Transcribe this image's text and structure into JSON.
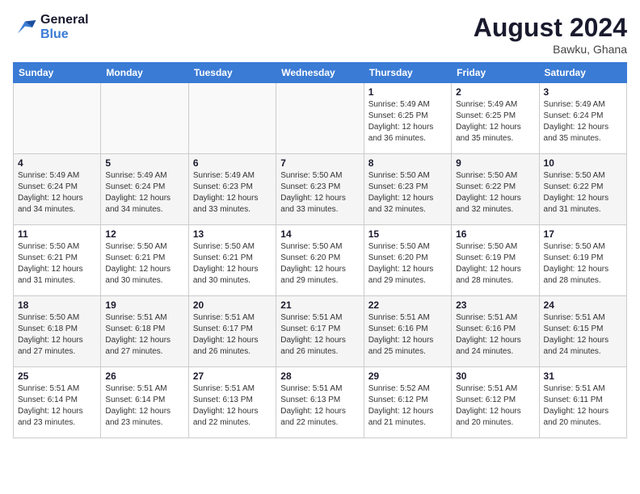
{
  "header": {
    "logo_line1": "General",
    "logo_line2": "Blue",
    "month_year": "August 2024",
    "location": "Bawku, Ghana"
  },
  "days_of_week": [
    "Sunday",
    "Monday",
    "Tuesday",
    "Wednesday",
    "Thursday",
    "Friday",
    "Saturday"
  ],
  "weeks": [
    [
      {
        "day": "",
        "info": ""
      },
      {
        "day": "",
        "info": ""
      },
      {
        "day": "",
        "info": ""
      },
      {
        "day": "",
        "info": ""
      },
      {
        "day": "1",
        "info": "Sunrise: 5:49 AM\nSunset: 6:25 PM\nDaylight: 12 hours\nand 36 minutes."
      },
      {
        "day": "2",
        "info": "Sunrise: 5:49 AM\nSunset: 6:25 PM\nDaylight: 12 hours\nand 35 minutes."
      },
      {
        "day": "3",
        "info": "Sunrise: 5:49 AM\nSunset: 6:24 PM\nDaylight: 12 hours\nand 35 minutes."
      }
    ],
    [
      {
        "day": "4",
        "info": "Sunrise: 5:49 AM\nSunset: 6:24 PM\nDaylight: 12 hours\nand 34 minutes."
      },
      {
        "day": "5",
        "info": "Sunrise: 5:49 AM\nSunset: 6:24 PM\nDaylight: 12 hours\nand 34 minutes."
      },
      {
        "day": "6",
        "info": "Sunrise: 5:49 AM\nSunset: 6:23 PM\nDaylight: 12 hours\nand 33 minutes."
      },
      {
        "day": "7",
        "info": "Sunrise: 5:50 AM\nSunset: 6:23 PM\nDaylight: 12 hours\nand 33 minutes."
      },
      {
        "day": "8",
        "info": "Sunrise: 5:50 AM\nSunset: 6:23 PM\nDaylight: 12 hours\nand 32 minutes."
      },
      {
        "day": "9",
        "info": "Sunrise: 5:50 AM\nSunset: 6:22 PM\nDaylight: 12 hours\nand 32 minutes."
      },
      {
        "day": "10",
        "info": "Sunrise: 5:50 AM\nSunset: 6:22 PM\nDaylight: 12 hours\nand 31 minutes."
      }
    ],
    [
      {
        "day": "11",
        "info": "Sunrise: 5:50 AM\nSunset: 6:21 PM\nDaylight: 12 hours\nand 31 minutes."
      },
      {
        "day": "12",
        "info": "Sunrise: 5:50 AM\nSunset: 6:21 PM\nDaylight: 12 hours\nand 30 minutes."
      },
      {
        "day": "13",
        "info": "Sunrise: 5:50 AM\nSunset: 6:21 PM\nDaylight: 12 hours\nand 30 minutes."
      },
      {
        "day": "14",
        "info": "Sunrise: 5:50 AM\nSunset: 6:20 PM\nDaylight: 12 hours\nand 29 minutes."
      },
      {
        "day": "15",
        "info": "Sunrise: 5:50 AM\nSunset: 6:20 PM\nDaylight: 12 hours\nand 29 minutes."
      },
      {
        "day": "16",
        "info": "Sunrise: 5:50 AM\nSunset: 6:19 PM\nDaylight: 12 hours\nand 28 minutes."
      },
      {
        "day": "17",
        "info": "Sunrise: 5:50 AM\nSunset: 6:19 PM\nDaylight: 12 hours\nand 28 minutes."
      }
    ],
    [
      {
        "day": "18",
        "info": "Sunrise: 5:50 AM\nSunset: 6:18 PM\nDaylight: 12 hours\nand 27 minutes."
      },
      {
        "day": "19",
        "info": "Sunrise: 5:51 AM\nSunset: 6:18 PM\nDaylight: 12 hours\nand 27 minutes."
      },
      {
        "day": "20",
        "info": "Sunrise: 5:51 AM\nSunset: 6:17 PM\nDaylight: 12 hours\nand 26 minutes."
      },
      {
        "day": "21",
        "info": "Sunrise: 5:51 AM\nSunset: 6:17 PM\nDaylight: 12 hours\nand 26 minutes."
      },
      {
        "day": "22",
        "info": "Sunrise: 5:51 AM\nSunset: 6:16 PM\nDaylight: 12 hours\nand 25 minutes."
      },
      {
        "day": "23",
        "info": "Sunrise: 5:51 AM\nSunset: 6:16 PM\nDaylight: 12 hours\nand 24 minutes."
      },
      {
        "day": "24",
        "info": "Sunrise: 5:51 AM\nSunset: 6:15 PM\nDaylight: 12 hours\nand 24 minutes."
      }
    ],
    [
      {
        "day": "25",
        "info": "Sunrise: 5:51 AM\nSunset: 6:14 PM\nDaylight: 12 hours\nand 23 minutes."
      },
      {
        "day": "26",
        "info": "Sunrise: 5:51 AM\nSunset: 6:14 PM\nDaylight: 12 hours\nand 23 minutes."
      },
      {
        "day": "27",
        "info": "Sunrise: 5:51 AM\nSunset: 6:13 PM\nDaylight: 12 hours\nand 22 minutes."
      },
      {
        "day": "28",
        "info": "Sunrise: 5:51 AM\nSunset: 6:13 PM\nDaylight: 12 hours\nand 22 minutes."
      },
      {
        "day": "29",
        "info": "Sunrise: 5:52 AM\nSunset: 6:12 PM\nDaylight: 12 hours\nand 21 minutes."
      },
      {
        "day": "30",
        "info": "Sunrise: 5:51 AM\nSunset: 6:12 PM\nDaylight: 12 hours\nand 20 minutes."
      },
      {
        "day": "31",
        "info": "Sunrise: 5:51 AM\nSunset: 6:11 PM\nDaylight: 12 hours\nand 20 minutes."
      }
    ]
  ]
}
